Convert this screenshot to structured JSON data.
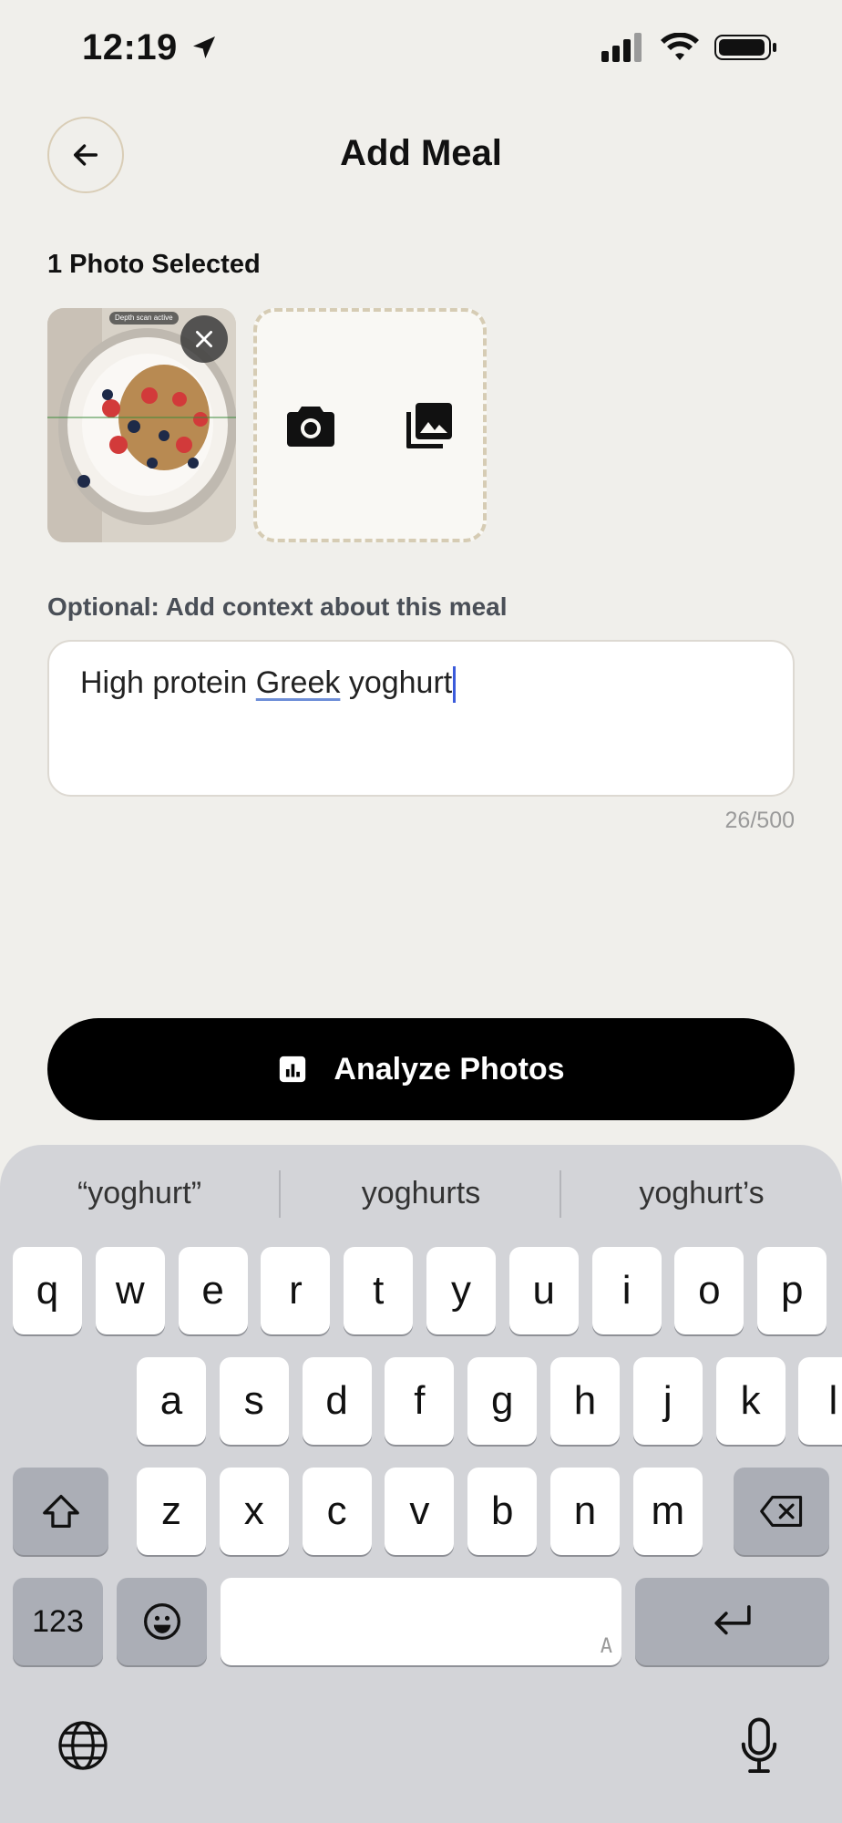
{
  "status": {
    "time": "12:19"
  },
  "header": {
    "title": "Add Meal"
  },
  "photos": {
    "section_label": "1 Photo Selected",
    "depth_tag": "Depth scan active"
  },
  "context": {
    "label": "Optional: Add context about this meal",
    "text_before": "High protein ",
    "text_underlined": "Greek",
    "text_after": " yoghurt",
    "counter": "26/500"
  },
  "analyze": {
    "label": "Analyze Photos"
  },
  "keyboard": {
    "suggestions": [
      "“yoghurt”",
      "yoghurts",
      "yoghurt’s"
    ],
    "row1": [
      "q",
      "w",
      "e",
      "r",
      "t",
      "y",
      "u",
      "i",
      "o",
      "p"
    ],
    "row2": [
      "a",
      "s",
      "d",
      "f",
      "g",
      "h",
      "j",
      "k",
      "l"
    ],
    "row3": [
      "z",
      "x",
      "c",
      "v",
      "b",
      "n",
      "m"
    ],
    "numbers_key": "123",
    "space_hint": "A"
  },
  "colors": {
    "background": "#f0efeb",
    "accent_border": "#d9cdb6",
    "button": "#000000",
    "caret": "#3b5bdb"
  }
}
